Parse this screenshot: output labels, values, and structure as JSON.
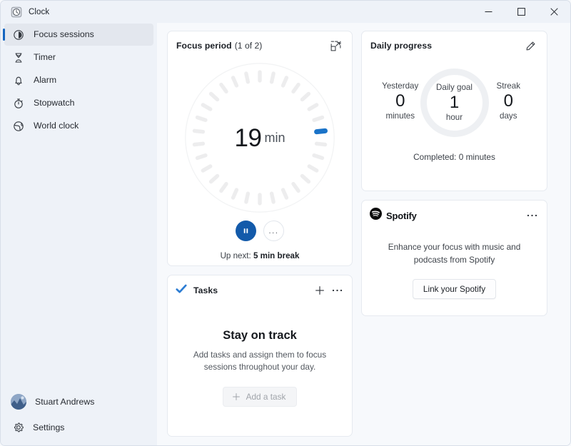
{
  "window": {
    "app_title": "Clock",
    "app_icon": "clock-app-icon",
    "controls": {
      "minimize": "minimize-icon",
      "maximize": "maximize-icon",
      "close": "close-icon"
    }
  },
  "sidebar": {
    "items": [
      {
        "label": "Focus sessions",
        "icon": "focus-sessions-icon",
        "active": true
      },
      {
        "label": "Timer",
        "icon": "hourglass-icon",
        "active": false
      },
      {
        "label": "Alarm",
        "icon": "bell-icon",
        "active": false
      },
      {
        "label": "Stopwatch",
        "icon": "stopwatch-icon",
        "active": false
      },
      {
        "label": "World clock",
        "icon": "globe-icon",
        "active": false
      }
    ],
    "account": {
      "name": "Stuart Andrews",
      "icon": "avatar"
    },
    "settings": {
      "label": "Settings",
      "icon": "gear-icon"
    }
  },
  "focus_period": {
    "title": "Focus period",
    "subtitle": "(1 of 2)",
    "mini_view_icon": "picture-in-picture-icon",
    "timer_value": "19",
    "timer_unit": "min",
    "ticks_total": 30,
    "active_tick_index": 7,
    "accent_color": "#1a73c8",
    "tick_color": "#ededee",
    "pause_button": "pause-icon",
    "more_button": "...",
    "up_next_label": "Up next:",
    "up_next_value": "5 min break"
  },
  "tasks": {
    "title": "Tasks",
    "icon": "tasks-check-icon",
    "add_icon": "plus-icon",
    "more_icon": "more-icon",
    "empty_title": "Stay on track",
    "empty_desc": "Add tasks and assign them to focus sessions throughout your day.",
    "add_task_label": "Add a task",
    "add_task_icon": "plus-icon"
  },
  "daily_progress": {
    "title": "Daily progress",
    "edit_icon": "pencil-edit-icon",
    "stats": [
      {
        "label": "Yesterday",
        "value": "0",
        "unit": "minutes"
      },
      {
        "label": "Streak",
        "value": "0",
        "unit": "days"
      }
    ],
    "goal": {
      "label": "Daily goal",
      "value": "1",
      "unit": "hour"
    },
    "completed": "Completed: 0 minutes"
  },
  "spotify": {
    "name": "Spotify",
    "logo_icon": "spotify-logo-icon",
    "more_icon": "more-icon",
    "description": "Enhance your focus with music and podcasts from Spotify",
    "link_button": "Link your Spotify"
  }
}
